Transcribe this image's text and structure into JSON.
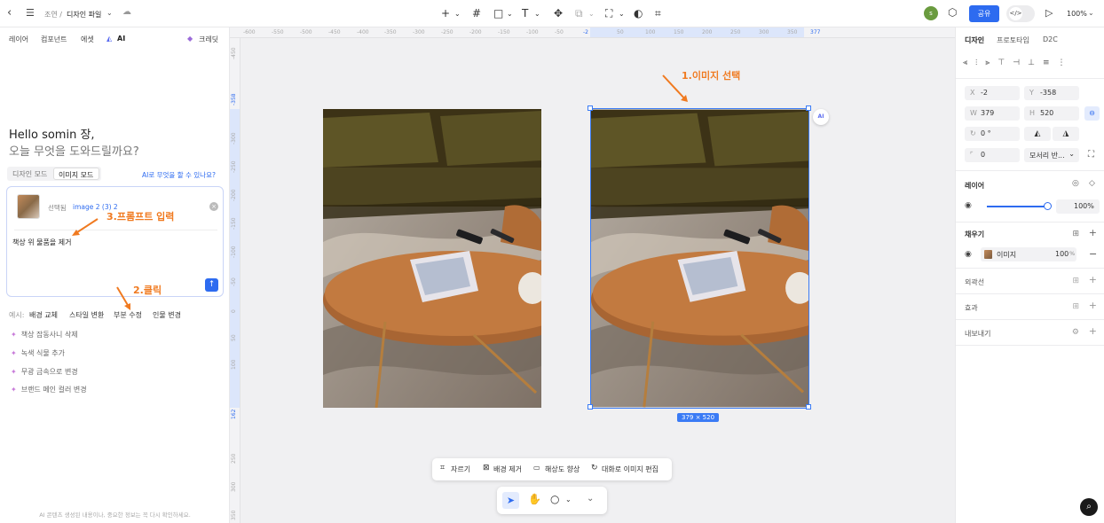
{
  "topbar": {
    "breadcrumb_parent": "조연 /",
    "file_name": "디자인 파일",
    "share_label": "공유",
    "zoom": "100%",
    "avatar_letter": "s"
  },
  "left": {
    "tabs": [
      "레이어",
      "컴포넌트",
      "에셋",
      "AI"
    ],
    "credit_label": "크레딧",
    "greeting_line1": "Hello somin 장,",
    "greeting_line2": "오늘 무엇을 도와드릴까요?",
    "mode_design": "디자인 모드",
    "mode_image": "이미지 모드",
    "help_link": "AI로 무엇을 할 수 있나요?",
    "selected_label": "선택됨",
    "selected_name": "image 2 (3) 2",
    "prompt_text": "책상 위 물품을 제거",
    "examples_label": "예시:",
    "example_chips": [
      "배경 교체",
      "스타일 변환",
      "부분 수정",
      "인물 변경"
    ],
    "suggestions": [
      "책상 잡동사니 삭제",
      "녹색 식물 추가",
      "무광 금속으로 변경",
      "브랜드 메인 컬러 변경"
    ],
    "disclaimer": "AI 콘텐츠 생성된 내용이나, 중요한 정보는 꼭 다시 확인하세요."
  },
  "annotations": {
    "step1": "1.이미지 선택",
    "step2": "2.클릭",
    "step3": "3.프롬프트 입력"
  },
  "ruler": {
    "top_ticks": [
      "-600",
      "-550",
      "-500",
      "-450",
      "-400",
      "-350",
      "-300",
      "-250",
      "-200",
      "-150",
      "-100",
      "-50",
      "-2",
      "50",
      "100",
      "150",
      "200",
      "250",
      "300",
      "350",
      "377"
    ],
    "left_ticks": [
      "-450",
      "-358",
      "-300",
      "-250",
      "-200",
      "-150",
      "-100",
      "-50",
      "0",
      "50",
      "100",
      "162",
      "250",
      "300",
      "350"
    ]
  },
  "canvas": {
    "size_badge": "379 × 520",
    "ai_badge": "AI"
  },
  "context_toolbar": [
    "자르기",
    "배경 제거",
    "해상도 향상",
    "대화로 이미지 편집"
  ],
  "right": {
    "tabs": [
      "디자인",
      "프로토타입",
      "D2C"
    ],
    "x_label": "X",
    "x_value": "-2",
    "y_label": "Y",
    "y_value": "-358",
    "w_label": "W",
    "w_value": "379",
    "h_label": "H",
    "h_value": "520",
    "rotation": "0 °",
    "radius": "0",
    "corner_mode": "모서리 반...",
    "layer_title": "레이어",
    "opacity": "100%",
    "fill_title": "채우기",
    "fill_name": "이미지",
    "fill_opacity": "100",
    "fill_opacity_unit": "%",
    "stroke_title": "외곽선",
    "effect_title": "효과",
    "export_title": "내보내기"
  },
  "colors": {
    "accent": "#2d6bf0",
    "annotation": "#f07a20",
    "canvas_bg": "#f0f0f2",
    "selection": "#3a7bf5"
  }
}
